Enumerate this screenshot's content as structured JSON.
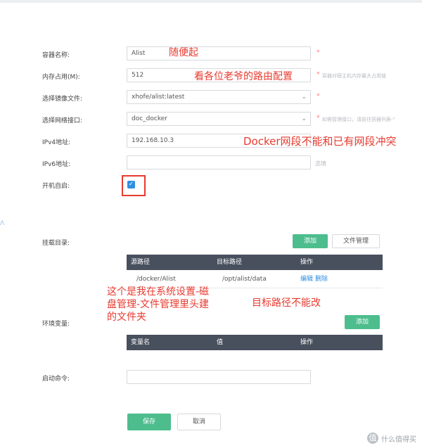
{
  "form": {
    "container_name": {
      "label": "容器名称:",
      "value": "Alist",
      "required": "*"
    },
    "memory": {
      "label": "内存占用(M):",
      "value": "512",
      "required": "*",
      "hint": "容器对宿主机内存最大占用值"
    },
    "image": {
      "label": "选择镜像文件:",
      "value": "xhofe/alist:latest",
      "required": "*"
    },
    "network": {
      "label": "选择网络接口:",
      "value": "doc_docker",
      "required": "*",
      "hint": "如需管理接口，请前往容器列表-“"
    },
    "ipv4": {
      "label": "IPv4地址:",
      "value": "192.168.10.3"
    },
    "ipv6": {
      "label": "IPv6地址:",
      "value": "",
      "hint": "选填"
    },
    "autostart": {
      "label": "开机自启:",
      "checked": true
    }
  },
  "mount": {
    "label": "挂载目录:",
    "add_label": "添加",
    "file_manager_label": "文件管理",
    "columns": [
      "源路径",
      "目标路径",
      "操作"
    ],
    "rows": [
      {
        "source": "/docker/Alist",
        "target": "/opt/alist/data",
        "edit": "编辑",
        "delete": "删除"
      }
    ]
  },
  "env": {
    "label": "环境变量:",
    "add_label": "添加",
    "columns": [
      "变量名",
      "值",
      "操作"
    ]
  },
  "startup": {
    "label": "启动命令:",
    "value": ""
  },
  "actions": {
    "save": "保存",
    "cancel": "取消"
  },
  "annotations": {
    "name_note": "随便起",
    "memory_note": "看各位老爷的路由配置",
    "ip_note": "Docker网段不能和已有网段冲突",
    "source_note": "这个是我在系统设置-磁盘管理-文件管理里头建的文件夹",
    "target_note": "目标路径不能改"
  },
  "watermark": {
    "badge": "值",
    "text": "什么值得买"
  },
  "colors": {
    "accent_green": "#4dbd8d",
    "table_header": "#48505e",
    "link_blue": "#2f8fe0",
    "annotation_red": "#e83a2f"
  }
}
